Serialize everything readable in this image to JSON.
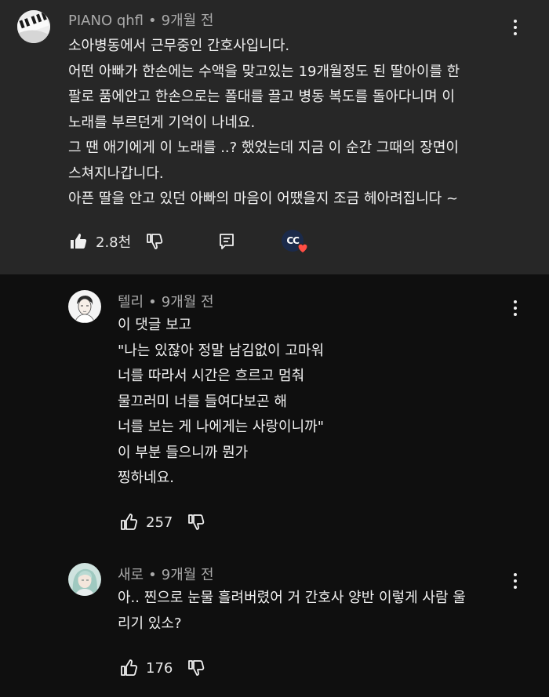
{
  "comments": [
    {
      "author": "PIANO qhfl",
      "time": "9개월 전",
      "lines": [
        "소아병동에서 근무중인 간호사입니다.",
        "어떤 아빠가 한손에는 수액을 맞고있는 19개월정도 된 딸아이를 한",
        "팔로 품에안고 한손으로는 폴대를 끌고 병동 복도를 돌아다니며 이",
        "노래를 부르던게 기억이 나네요.",
        "그 땐 애기에게 이 노래를 ..? 했었는데 지금 이 순간 그때의 장면이",
        "스쳐지나갑니다.",
        "아픈 딸을 안고 있던 아빠의 마음이 어땠을지 조금 헤아려집니다 ~"
      ],
      "likes": "2.8천",
      "hearted_badge": "CC"
    },
    {
      "author": "텔리",
      "time": "9개월 전",
      "lines": [
        "이 댓글 보고",
        "\"나는 있잖아 정말 남김없이 고마워",
        "너를 따라서 시간은 흐르고 멈춰",
        "물끄러미 너를 들여다보곤 해",
        "너를 보는 게 나에게는 사랑이니까\"",
        "이 부분 들으니까 뭔가",
        "찡하네요."
      ],
      "likes": "257"
    },
    {
      "author": "새로",
      "time": "9개월 전",
      "lines": [
        "아.. 찐으로 눈물 흘려버렸어 거 간호사 양반 이렇게 사람 울",
        "리기 있소?"
      ],
      "likes": "176"
    }
  ],
  "colors": {
    "highlight_bg": "#272727",
    "page_bg": "#0f0f0f",
    "text": "#f1f1f1",
    "meta": "#aaaaaa",
    "heart": "#ff4e45"
  },
  "icons": [
    "like-icon-filled",
    "like-icon",
    "dislike-icon",
    "reply-icon",
    "more-vert-icon",
    "heart-icon"
  ]
}
